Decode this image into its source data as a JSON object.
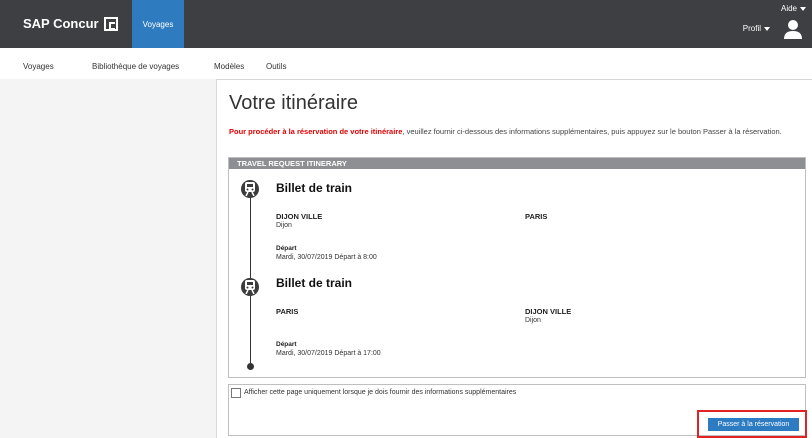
{
  "header": {
    "brand": "SAP Concur",
    "active_tab": "Voyages",
    "help": "Aide",
    "profile": "Profil"
  },
  "subnav": {
    "items": [
      {
        "label": "Voyages"
      },
      {
        "label": "Bibliothèque de voyages"
      },
      {
        "label": "Modèles"
      },
      {
        "label": "Outils"
      }
    ]
  },
  "page": {
    "title": "Votre itinéraire",
    "intro_red": "Pour procéder à la réservation de votre itinéraire",
    "intro_rest": ", veuillez fournir ci-dessous des informations supplémentaires, puis appuyez sur le bouton Passer à la réservation."
  },
  "itinerary": {
    "header": "TRAVEL REQUEST ITINERARY",
    "segments": [
      {
        "title": "Billet de train",
        "from_city": "DIJON VILLE",
        "from_sub": "Dijon",
        "to_city": "PARIS",
        "to_sub": "",
        "departure_label": "Départ",
        "departure_text": "Mardi, 30/07/2019 Départ à 8:00"
      },
      {
        "title": "Billet de train",
        "from_city": "PARIS",
        "from_sub": "",
        "to_city": "DIJON VILLE",
        "to_sub": "Dijon",
        "departure_label": "Départ",
        "departure_text": "Mardi, 30/07/2019 Départ à 17:00"
      }
    ]
  },
  "footer": {
    "checkbox_label": "Afficher cette page uniquement lorsque je dois fournir des informations supplémentaires",
    "button_label": "Passer à la réservation"
  },
  "colors": {
    "header_bg": "#3d3f42",
    "accent": "#2e7bbf",
    "highlight": "#e02323",
    "warning_text": "#dd0000"
  }
}
